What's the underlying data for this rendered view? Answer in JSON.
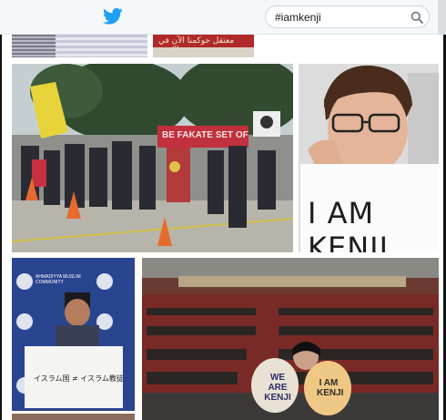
{
  "header": {
    "search_value": "#iamkenji"
  },
  "colors": {
    "twitter_blue": "#1da1f2"
  },
  "tiles": {
    "top_right_banner_text": "معتقل حوكمنا الآن في الاردن",
    "protest_banner_text": "BE FAKATE SET OF",
    "kenji_sign_text": "I AM KENJI",
    "muslim_sign_text": "イスラム国 ≠ イスラム教徒",
    "muslim_logo_text": "AHMADIYYA MUSLIM COMMUNITY",
    "we_are_kenji_text": "WE ARE KENJI",
    "i_am_kenji_round_text": "I AM KENJI",
    "crowd_sign_text": "I AM KENJI"
  }
}
